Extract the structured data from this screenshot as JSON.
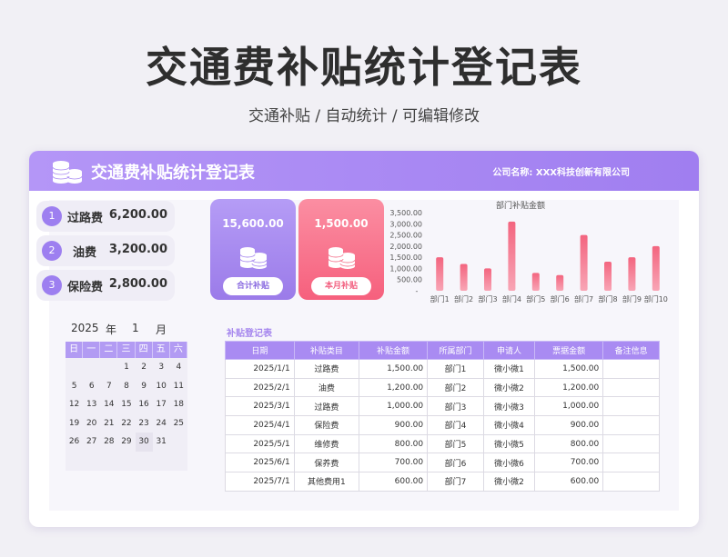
{
  "title": "交通费补贴统计登记表",
  "subtitle": "交通补贴 /  自动统计  /  可编辑修改",
  "header": {
    "title": "交通费补贴统计登记表",
    "company": "公司名称:  XXX科技创新有限公司"
  },
  "fees": [
    {
      "num": "1",
      "label": "过路费",
      "value": "6,200.00"
    },
    {
      "num": "2",
      "label": "油费",
      "value": "3,200.00"
    },
    {
      "num": "3",
      "label": "保险费",
      "value": "2,800.00"
    }
  ],
  "summary": {
    "total_value": "15,600.00",
    "total_label": "合计补贴",
    "month_value": "1,500.00",
    "month_label": "本月补贴"
  },
  "colors": {
    "accent": "#a07ef0",
    "pink": "#f6607d",
    "bar": "#f17a92"
  },
  "chart_data": {
    "type": "bar",
    "title": "部门补贴金额",
    "categories": [
      "部门1",
      "部门2",
      "部门3",
      "部门4",
      "部门5",
      "部门6",
      "部门7",
      "部门8",
      "部门9",
      "部门10"
    ],
    "values": [
      1500,
      1200,
      1000,
      3100,
      800,
      700,
      2500,
      1300,
      1500,
      2000
    ],
    "yticks": [
      "3,500.00",
      "3,000.00",
      "2,500.00",
      "2,000.00",
      "1,500.00",
      "1,000.00",
      "500.00",
      "-"
    ],
    "ylim": [
      0,
      3500
    ]
  },
  "calendar": {
    "year": "2025",
    "year_unit": "年",
    "month": "1",
    "month_unit": "月",
    "weekdays": [
      "日",
      "一",
      "二",
      "三",
      "四",
      "五",
      "六"
    ],
    "rows": [
      [
        "",
        "",
        "",
        "1",
        "2",
        "3",
        "4"
      ],
      [
        "5",
        "6",
        "7",
        "8",
        "9",
        "10",
        "11"
      ],
      [
        "12",
        "13",
        "14",
        "15",
        "16",
        "17",
        "18"
      ],
      [
        "19",
        "20",
        "21",
        "22",
        "23",
        "24",
        "25"
      ],
      [
        "26",
        "27",
        "28",
        "29",
        "30",
        "31",
        ""
      ],
      [
        "",
        "",
        "",
        "",
        "",
        "",
        ""
      ]
    ],
    "today": "30"
  },
  "register": {
    "title": "补贴登记表",
    "columns": [
      "日期",
      "补贴类目",
      "补贴金额",
      "所属部门",
      "申请人",
      "票据金额",
      "备注信息"
    ],
    "rows": [
      [
        "2025/1/1",
        "过路费",
        "1,500.00",
        "部门1",
        "微小微1",
        "1,500.00",
        ""
      ],
      [
        "2025/2/1",
        "油费",
        "1,200.00",
        "部门2",
        "微小微2",
        "1,200.00",
        ""
      ],
      [
        "2025/3/1",
        "过路费",
        "1,000.00",
        "部门3",
        "微小微3",
        "1,000.00",
        ""
      ],
      [
        "2025/4/1",
        "保险费",
        "900.00",
        "部门4",
        "微小微4",
        "900.00",
        ""
      ],
      [
        "2025/5/1",
        "维修费",
        "800.00",
        "部门5",
        "微小微5",
        "800.00",
        ""
      ],
      [
        "2025/6/1",
        "保养费",
        "700.00",
        "部门6",
        "微小微6",
        "700.00",
        ""
      ],
      [
        "2025/7/1",
        "其他费用1",
        "600.00",
        "部门7",
        "微小微2",
        "600.00",
        ""
      ]
    ]
  }
}
